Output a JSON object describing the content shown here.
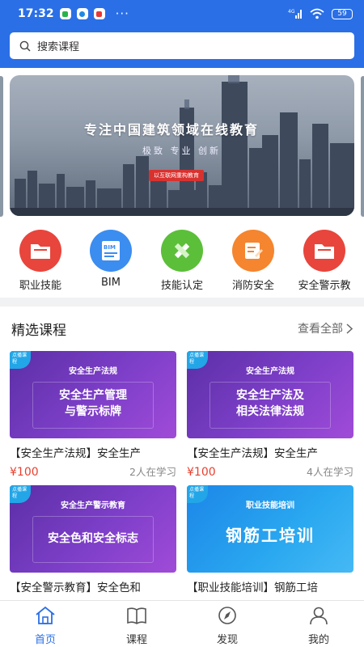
{
  "status_bar": {
    "time": "17:32",
    "network": "4G",
    "battery": "59",
    "more": "···"
  },
  "search": {
    "placeholder": "搜索课程"
  },
  "banner": {
    "title": "专注中国建筑领域在线教育",
    "subtitle": "极致  专业  创新",
    "tag": "以互联网重构教育"
  },
  "categories": [
    {
      "label": "职业技能",
      "icon": "folder-icon",
      "color": "#e8453c"
    },
    {
      "label": "BIM",
      "icon": "bim-document-icon",
      "color": "#3b8df0"
    },
    {
      "label": "技能认定",
      "icon": "ruler-pencil-icon",
      "color": "#5cbf3a"
    },
    {
      "label": "消防安全",
      "icon": "edit-note-icon",
      "color": "#f5852e"
    },
    {
      "label": "安全警示教",
      "icon": "folder-icon",
      "color": "#e8453c"
    }
  ],
  "featured": {
    "title": "精选课程",
    "see_all": "查看全部"
  },
  "courses": [
    {
      "badge": "点播课程",
      "thumb_head": "安全生产法规",
      "thumb_main": "安全生产管理\n与警示标牌",
      "title": "【安全生产法规】安全生产",
      "price": "¥100",
      "learners": "2人在学习"
    },
    {
      "badge": "点播课程",
      "thumb_head": "安全生产法规",
      "thumb_main": "安全生产法及\n相关法律法规",
      "title": "【安全生产法规】安全生产",
      "price": "¥100",
      "learners": "4人在学习"
    },
    {
      "badge": "点播课程",
      "thumb_head": "安全生产警示教育",
      "thumb_main": "安全色和安全标志",
      "title": "【安全警示教育】安全色和"
    },
    {
      "badge": "点播课程",
      "thumb_head": "职业技能培训",
      "thumb_main": "钢筋工培训",
      "title": "【职业技能培训】钢筋工培"
    }
  ],
  "tabs": [
    {
      "label": "首页",
      "icon": "home-icon",
      "active": true
    },
    {
      "label": "课程",
      "icon": "book-icon",
      "active": false
    },
    {
      "label": "发现",
      "icon": "compass-icon",
      "active": false
    },
    {
      "label": "我的",
      "icon": "user-icon",
      "active": false
    }
  ],
  "colors": {
    "primary": "#2a6fe6",
    "price": "#e8402f"
  }
}
